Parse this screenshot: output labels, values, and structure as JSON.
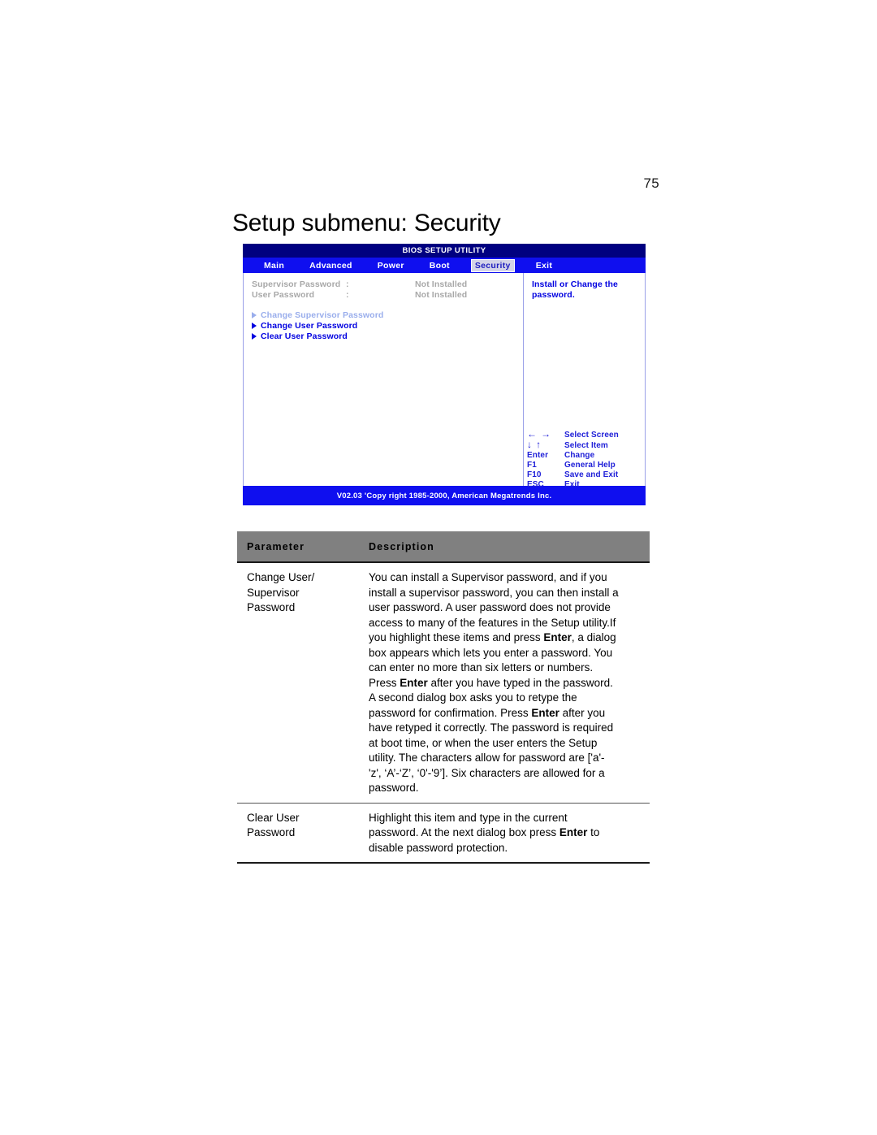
{
  "page": {
    "number": "75",
    "title": "Setup submenu: Security"
  },
  "bios": {
    "title": "BIOS SETUP UTILITY",
    "menu": [
      {
        "label": "Main",
        "active": false
      },
      {
        "label": "Advanced",
        "active": false
      },
      {
        "label": "Power",
        "active": false
      },
      {
        "label": "Boot",
        "active": false
      },
      {
        "label": "Security",
        "active": true
      },
      {
        "label": "Exit",
        "active": false
      }
    ],
    "status_rows": [
      {
        "label": "Supervisor Password",
        "colon": ":",
        "value": "Not Installed"
      },
      {
        "label": "User Password",
        "colon": ":",
        "value": "Not Installed"
      }
    ],
    "menu_items": [
      {
        "label": "Change Supervisor Password",
        "disabled": true
      },
      {
        "label": "Change User Password",
        "disabled": false
      },
      {
        "label": "Clear User Password",
        "disabled": false
      }
    ],
    "help": {
      "line1": "Install or Change the",
      "line2": "password."
    },
    "legend": [
      {
        "key": "← →",
        "is_arrows": true,
        "arrows": [
          "←",
          "→"
        ],
        "desc": "Select Screen"
      },
      {
        "key": "↓ ↑",
        "is_arrows": true,
        "arrows": [
          "↓",
          "↑"
        ],
        "desc": "Select Item"
      },
      {
        "key": "Enter",
        "is_arrows": false,
        "desc": "Change"
      },
      {
        "key": "F1",
        "is_arrows": false,
        "desc": "General Help"
      },
      {
        "key": "F10",
        "is_arrows": false,
        "desc": "Save and Exit"
      },
      {
        "key": "ESC",
        "is_arrows": false,
        "desc": "Exit"
      }
    ],
    "footer": "V02.03 'Copy right 1985-2000, American Megatrends Inc.",
    "colors": {
      "title_bar": "#000080",
      "menu_bar": "#0f0fef",
      "text_blue": "#0000e0",
      "disabled_gray": "#a8a8a8",
      "disabled_blue": "#9aaeec"
    }
  },
  "table": {
    "headers": {
      "parameter": "Parameter",
      "description": "Description"
    },
    "rows": [
      {
        "parameter_lines": [
          "Change User/",
          "Supervisor",
          "Password"
        ],
        "description_lines": [
          [
            {
              "t": "You can install a Supervisor password, and if you",
              "b": false
            }
          ],
          [
            {
              "t": "install a supervisor password, you can then install a",
              "b": false
            }
          ],
          [
            {
              "t": "user password. A user password does not provide",
              "b": false
            }
          ],
          [
            {
              "t": "access to many of the features in the Setup utility.If",
              "b": false
            }
          ],
          [
            {
              "t": "you highlight these items and press ",
              "b": false
            },
            {
              "t": "Enter",
              "b": true
            },
            {
              "t": ", a dialog",
              "b": false
            }
          ],
          [
            {
              "t": "box appears which lets you enter a password. You",
              "b": false
            }
          ],
          [
            {
              "t": "can enter no more than six letters or numbers.",
              "b": false
            }
          ],
          [
            {
              "t": "Press ",
              "b": false
            },
            {
              "t": "Enter",
              "b": true
            },
            {
              "t": " after you have typed in the password.",
              "b": false
            }
          ],
          [
            {
              "t": "A second dialog box asks you to retype the",
              "b": false
            }
          ],
          [
            {
              "t": "password for confirmation. Press ",
              "b": false
            },
            {
              "t": "Enter",
              "b": true
            },
            {
              "t": " after you",
              "b": false
            }
          ],
          [
            {
              "t": "have retyped it correctly. The password is required",
              "b": false
            }
          ],
          [
            {
              "t": "at boot time, or when the user enters the Setup",
              "b": false
            }
          ],
          [
            {
              "t": "utility. The characters allow for password are ['a'-",
              "b": false
            }
          ],
          [
            {
              "t": "'z', ‘A’-‘Z’, ‘0'-'9’]. Six characters are allowed for a",
              "b": false
            }
          ],
          [
            {
              "t": "password.",
              "b": false
            }
          ]
        ]
      },
      {
        "parameter_lines": [
          "Clear User",
          "Password"
        ],
        "description_lines": [
          [
            {
              "t": "Highlight this item and type in the current",
              "b": false
            }
          ],
          [
            {
              "t": "password. At the next dialog box press ",
              "b": false
            },
            {
              "t": "Enter",
              "b": true
            },
            {
              "t": " to",
              "b": false
            }
          ],
          [
            {
              "t": "disable password protection.",
              "b": false
            }
          ]
        ]
      }
    ]
  }
}
